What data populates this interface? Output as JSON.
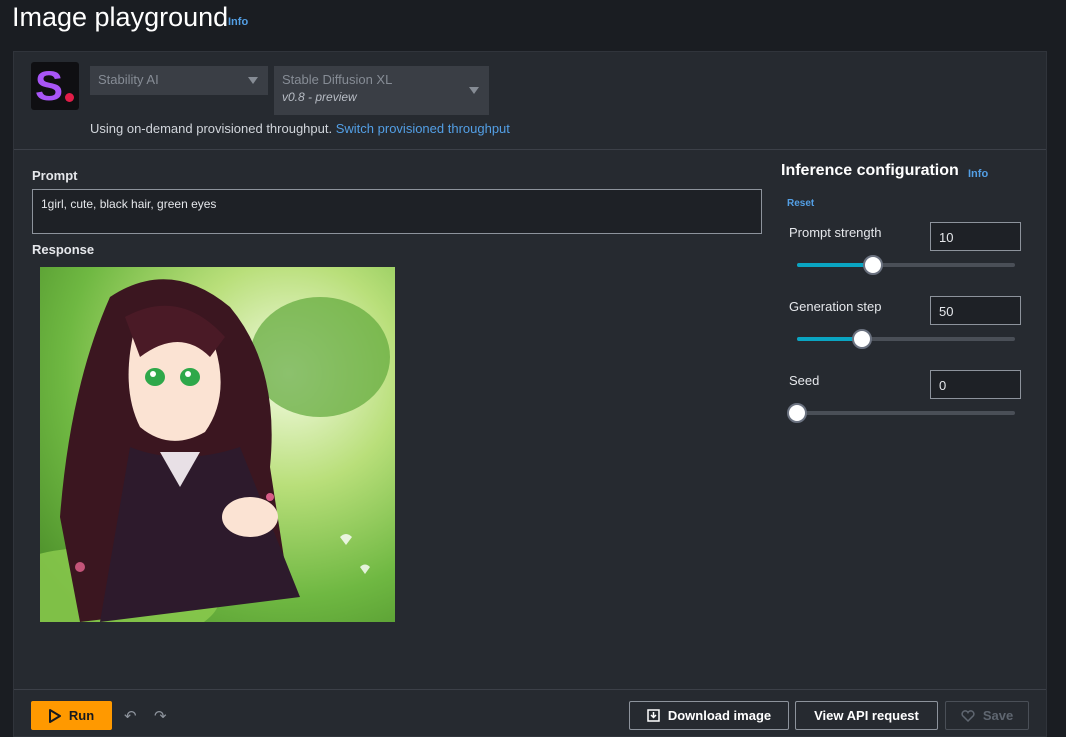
{
  "page": {
    "title": "Image playground",
    "info": "Info"
  },
  "model": {
    "provider": "Stability AI",
    "model_name": "Stable Diffusion XL",
    "version": "v0.8 - preview",
    "throughput_text": "Using on-demand provisioned throughput.",
    "throughput_link": "Switch provisioned throughput"
  },
  "prompt": {
    "label": "Prompt",
    "value": "1girl, cute, black hair, green eyes"
  },
  "response": {
    "label": "Response"
  },
  "inference": {
    "title": "Inference configuration",
    "info": "Info",
    "reset": "Reset",
    "params": [
      {
        "label": "Prompt strength",
        "value": "10",
        "level": 0.35
      },
      {
        "label": "Generation step",
        "value": "50",
        "level": 0.3
      },
      {
        "label": "Seed",
        "value": "0",
        "level": 0.0
      }
    ]
  },
  "footer": {
    "run": "Run",
    "download": "Download image",
    "api": "View API request",
    "save": "Save"
  },
  "colors": {
    "accent": "#ff9900",
    "link": "#539fe5",
    "slider": "#0aa5c2"
  }
}
